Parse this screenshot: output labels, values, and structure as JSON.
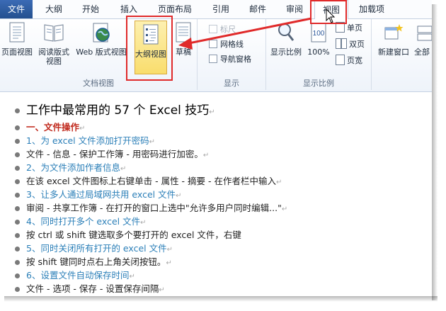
{
  "tabs": [
    "文件",
    "大纲",
    "开始",
    "插入",
    "页面布局",
    "引用",
    "邮件",
    "审阅",
    "视图",
    "加载项"
  ],
  "ribbon": {
    "group_docview": {
      "label": "文档视图",
      "buttons": [
        "页面视图",
        "阅读版式视图",
        "Web 版式视图",
        "大纲视图",
        "草稿"
      ]
    },
    "group_show": {
      "label": "显示",
      "items": [
        "标尺",
        "网格线",
        "导航窗格"
      ]
    },
    "group_zoom": {
      "label": "显示比例",
      "buttons": [
        "显示比例",
        "100%"
      ],
      "small": [
        "单页",
        "双页",
        "页宽"
      ]
    },
    "group_window": {
      "buttons": [
        "新建窗口",
        "全部"
      ]
    }
  },
  "document": {
    "lines": [
      {
        "text": "工作中最常用的 57 个 Excel 技巧",
        "style": "title",
        "mark": "↵"
      },
      {
        "text": "一、文件操作",
        "style": "head",
        "mark": "↵"
      },
      {
        "text": "1、为 excel 文件添加打开密码",
        "style": "blue",
        "mark": "↵"
      },
      {
        "text": "文件 - 信息 - 保护工作簿 - 用密码进行加密。",
        "style": "lvl2",
        "mark": "↵"
      },
      {
        "text": "2、为文件添加作者信息",
        "style": "blue",
        "mark": "↵"
      },
      {
        "text": "在该 excel 文件图标上右键单击 - 属性 - 摘要 - 在作者栏中输入",
        "style": "lvl2",
        "mark": "↵"
      },
      {
        "text": "3、让多人通过局域网共用 excel 文件",
        "style": "blue",
        "mark": "↵"
      },
      {
        "text": "审阅 - 共享工作簿 - 在打开的窗口上选中\"允许多用户同时编辑...\"",
        "style": "lvl2",
        "mark": "↵"
      },
      {
        "text": "4、同时打开多个 excel 文件",
        "style": "blue",
        "mark": "↵"
      },
      {
        "text": "按 ctrl 或 shift 键选取多个要打开的 excel 文件，右键",
        "style": "lvl2",
        "mark": ""
      },
      {
        "text": "5、同时关闭所有打开的 excel 文件",
        "style": "blue",
        "mark": "↵"
      },
      {
        "text": "按 shift 键同时点右上角关闭按钮。",
        "style": "lvl2",
        "mark": "↵"
      },
      {
        "text": "6、设置文件自动保存时间",
        "style": "blue",
        "mark": "↵"
      },
      {
        "text": "文件 - 选项 - 保存 - 设置保存间隔",
        "style": "lvl2",
        "mark": "↵"
      }
    ]
  },
  "colors": {
    "annotation": "#e02a2a",
    "file_tab": "#2b579a",
    "heading": "#c0281b",
    "link_blue": "#2b7fb8",
    "outline_selected": "#f9dd6d"
  }
}
